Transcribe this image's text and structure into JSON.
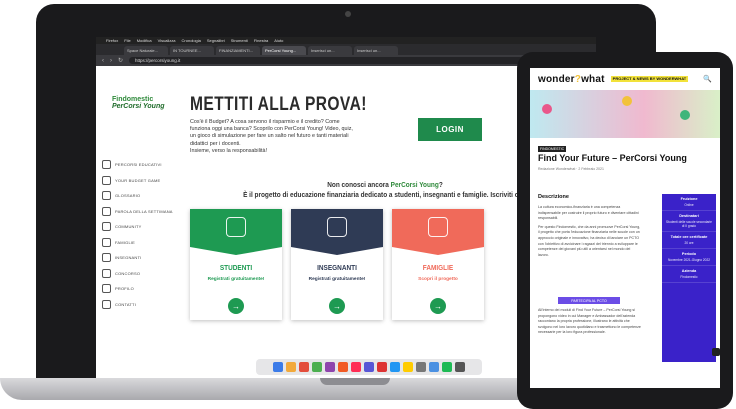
{
  "laptop": {
    "menubar": [
      "Firefox",
      "File",
      "Modifica",
      "Visualizza",
      "Cronologia",
      "Segnalibri",
      "Strumenti",
      "Finestra",
      "Aiuto"
    ],
    "tabs": [
      "Space Naturale...",
      "IN TOURNEE...",
      "FINANZIAMENTI...",
      "PerCorsi Young...",
      "Inserisci un...",
      "Inserisci un..."
    ],
    "url": "https://percorsiyoung.it",
    "logo": {
      "top": "Findomestic",
      "bottom": "PerCorsi Young"
    },
    "sidebar": [
      "PERCORSI EDUCATIVI",
      "YOUR BUDGET GAME",
      "GLOSSARIO",
      "PAROLA DELLA SETTIMANA",
      "COMMUNITY",
      "FAMIGLIE",
      "INSEGNANTI",
      "CONCORSO",
      "PROFILO",
      "CONTATTI"
    ],
    "headline": "METTITI ALLA PROVA!",
    "intro_lines": [
      "Cos'è il Budget? A cosa servono il risparmio e il credito? Come",
      "funziona oggi una banca? Scoprilo con PerCorsi Young! Video, quiz,",
      "un gioco di simulazione per fare un salto nel futuro e tanti materiali",
      "didattici per i docenti.",
      "Insieme, verso la responsabilità!"
    ],
    "login_label": "LOGIN",
    "question_prefix": "Non conosci ancora ",
    "question_highlight": "PerCorsi Young",
    "question_suffix": "?",
    "subline": "È il progetto di educazione finanziaria dedicato a studenti, insegnanti e famiglie. Iscriviti ora!",
    "cards": [
      {
        "title": "STUDENTI",
        "sub": "Registrati gratuitamente!",
        "color": "#1e9a52",
        "title_color": "#1e9a52"
      },
      {
        "title": "INSEGNANTI",
        "sub": "Registrati gratuitamente!",
        "color": "#2f3b55",
        "title_color": "#2f3b55"
      },
      {
        "title": "FAMIGLIE",
        "sub": "Scopri il progetto",
        "color": "#f06a5a",
        "title_color": "#f06a5a"
      }
    ],
    "go_symbol": "→",
    "dock_colors": [
      "#3b7be8",
      "#f2a93b",
      "#e34d3b",
      "#4caf50",
      "#8e44ad",
      "#f15a24",
      "#ff2d55",
      "#5856d6",
      "#d33",
      "#2196f3",
      "#ffcc00",
      "#777",
      "#4a90e2",
      "#1db954",
      "#555"
    ]
  },
  "tablet": {
    "brand": "wonder",
    "brand2": "what",
    "badge": "PROJECT & NEWS BY WONDERWHAT",
    "search_icon": "🔍",
    "category": "FINDOMESTIC",
    "title": "Find Your Future – PerCorsi Young",
    "meta": "Redazione Wonderwhat · 2 Febbraio 2021",
    "desc_heading": "Descrizione",
    "paragraphs": [
      "La cultura economico-finanziaria è una competenza indispensabile per costruire il proprio futuro e diventare cittadini responsabili.",
      "Per questo Findomestic, che da anni promuove PerCorsi Young, il progetto che porta l'educazione finanziaria nelle scuole con un approccio originale e innovativo, ha deciso di lanciare un PCTO con l'obiettivo di avvicinare i ragazzi del triennio a sviluppare le competenze dei giovani più utili a orientarsi nel mondo del lavoro."
    ],
    "cta": "PARTECIPA AL PCTO",
    "paragraph_after": "All'interno dei moduli di Find Your Future – PerCorsi Young si propongono video in cui Manager e Ambassador dell'azienda raccontano la propria professione, illustrano le attività che svolgono nel loro lavoro quotidiano e trasmettono le competenze necessarie per la loro figura professionale.",
    "panel": [
      {
        "label": "Fruizione",
        "value": "Online"
      },
      {
        "label": "Destinatari",
        "value": "Studenti delle scuole secondarie di II grado"
      },
      {
        "label": "Totale ore certificate",
        "value": "20 ore"
      },
      {
        "label": "Periodo",
        "value": "Novembre 2021-Giugno 2022"
      },
      {
        "label": "Azienda",
        "value": "Findomestic"
      }
    ]
  }
}
